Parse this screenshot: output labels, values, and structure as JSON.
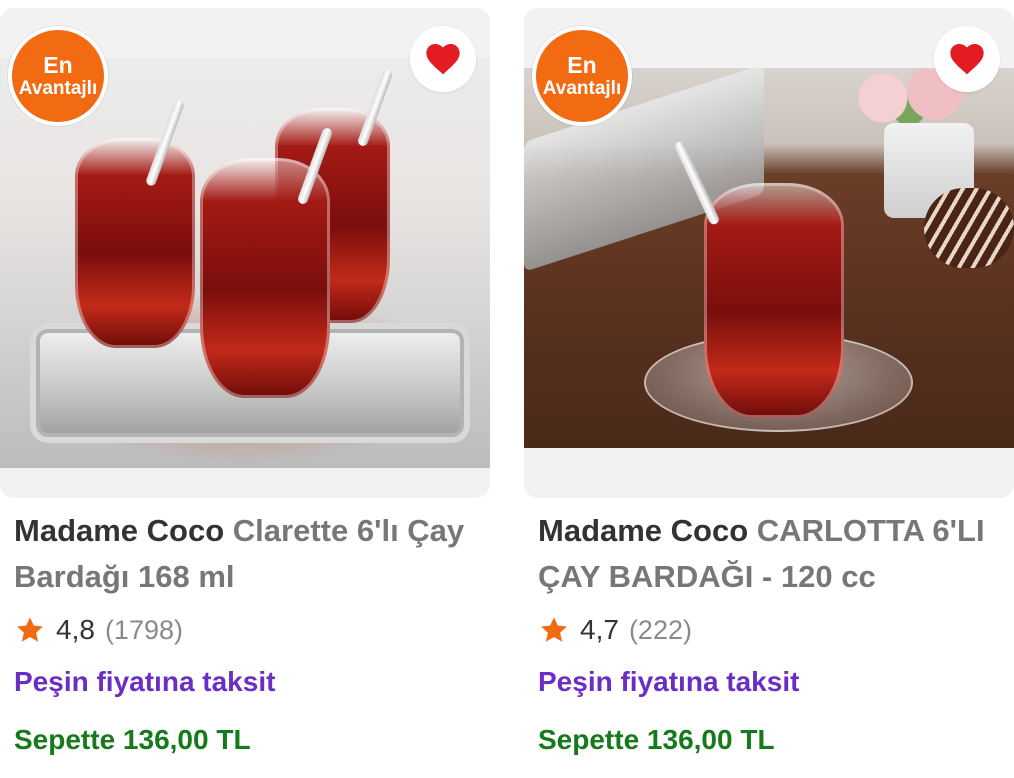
{
  "colors": {
    "badge": "#f26a12",
    "heart": "#e31b23",
    "star": "#f26a12",
    "installment": "#6a2ec5",
    "basket_price": "#167a1a"
  },
  "products": [
    {
      "badge_line1": "En",
      "badge_line2": "Avantajlı",
      "favorite_icon": "heart-icon",
      "brand": "Madame Coco",
      "name": "Clarette 6'lı Çay Bardağı 168 ml",
      "rating": "4,8",
      "review_count": "(1798)",
      "installment_text": "Peşin fiyatına taksit",
      "basket_price": "Sepette 136,00 TL"
    },
    {
      "badge_line1": "En",
      "badge_line2": "Avantajlı",
      "favorite_icon": "heart-icon",
      "brand": "Madame Coco",
      "name": "CARLOTTA 6'LI ÇAY BARDAĞI - 120 cc",
      "rating": "4,7",
      "review_count": "(222)",
      "installment_text": "Peşin fiyatına taksit",
      "basket_price": "Sepette 136,00 TL"
    }
  ]
}
